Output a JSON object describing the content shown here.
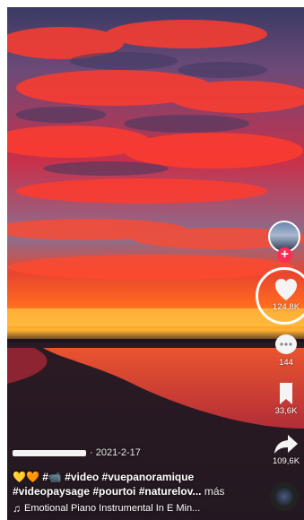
{
  "post": {
    "date": "2021-2-17",
    "emojis": "💛🧡 #📹",
    "caption_line1": "#video #vuepanoramique",
    "caption_line2": "#videopaysage #pourtoi #naturelov...",
    "more_label": "más"
  },
  "music": {
    "note_icon": "♫",
    "track": "Emotional Piano Instrumental In E Min..."
  },
  "actions": {
    "follow_icon": "+",
    "likes": "124,8K",
    "comments": "144",
    "saves": "33,6K",
    "shares": "109,6K"
  },
  "colors": {
    "like_highlight": "#ffffff",
    "follow": "#fe2c55"
  }
}
